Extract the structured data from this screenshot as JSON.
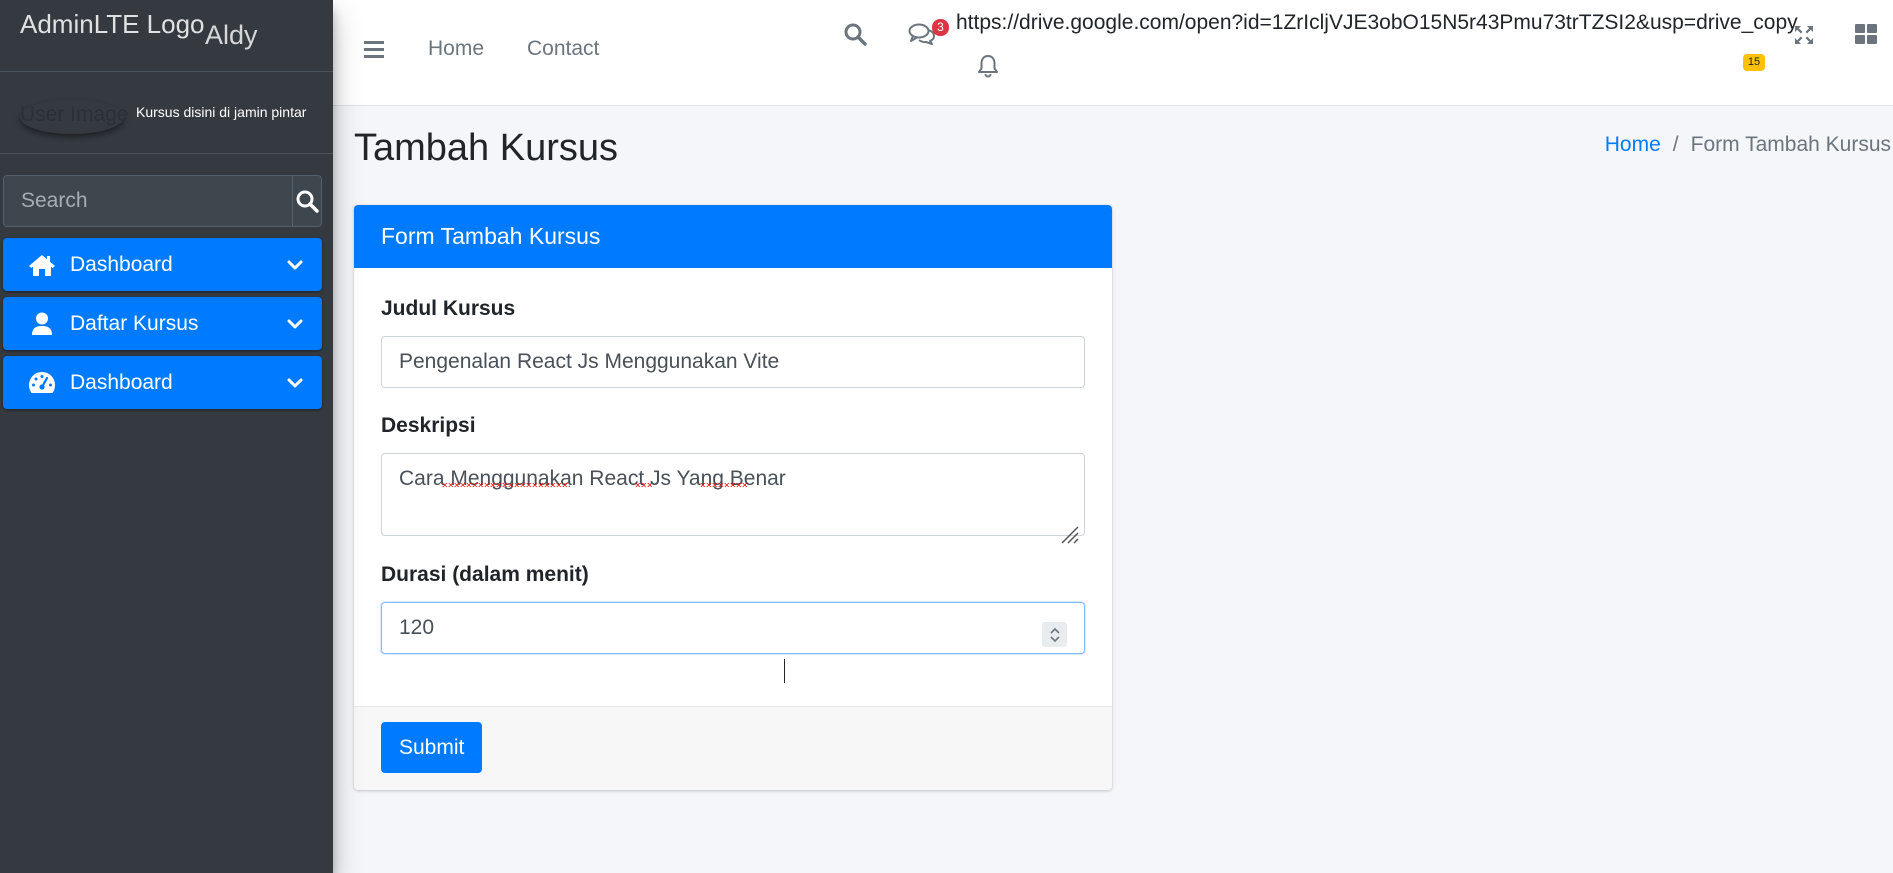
{
  "sidebar": {
    "brand_logo": "AdminLTE Logo",
    "brand_text": "Aldy",
    "user_image_alt": "User Image",
    "user_name": "Kursus disini di jamin pintar",
    "search_placeholder": "Search",
    "items": [
      {
        "label": "Dashboard",
        "icon": "home-icon"
      },
      {
        "label": "Daftar Kursus",
        "icon": "user-icon"
      },
      {
        "label": "Dashboard",
        "icon": "tachometer-icon"
      }
    ]
  },
  "navbar": {
    "links": [
      "Home",
      "Contact"
    ],
    "messages_badge": "3",
    "notifications_badge": "15",
    "url_text": "https://drive.google.com/open?id=1ZrIcljVJE3obO15N5r43Pmu73trTZSI2&usp=drive_copy"
  },
  "page": {
    "title": "Tambah Kursus",
    "breadcrumb": {
      "home": "Home",
      "separator": "/",
      "active": "Form Tambah Kursus"
    }
  },
  "form": {
    "header": "Form Tambah Kursus",
    "judul_label": "Judul Kursus",
    "judul_value": "Pengenalan React Js Menggunakan Vite",
    "deskripsi_label": "Deskripsi",
    "deskripsi_value": "Cara Menggunakan React Js Yang Benar",
    "durasi_label": "Durasi (dalam menit)",
    "durasi_value": "120",
    "submit_label": "Submit"
  },
  "colors": {
    "primary": "#007bff",
    "sidebar_bg": "#343a40",
    "content_bg": "#f4f6f9",
    "badge_danger": "#dc3545",
    "badge_warning": "#ffc107"
  }
}
